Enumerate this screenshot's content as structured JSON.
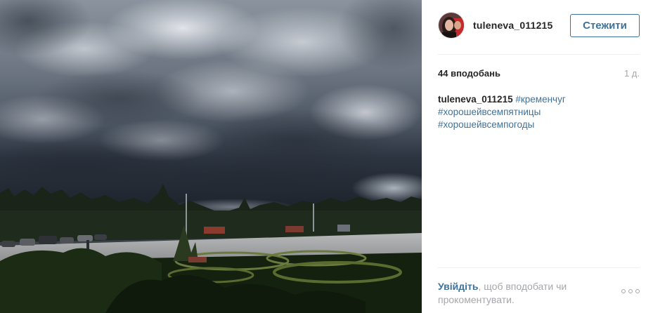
{
  "post": {
    "username": "tuleneva_011215",
    "follow_label": "Стежити",
    "likes": "44 вподобань",
    "time": "1 д.",
    "caption": {
      "author": "tuleneva_011215",
      "tags": [
        "#кременчуг",
        "#хорошейвсемпятницы",
        "#хорошейвсемпогоды"
      ]
    },
    "footer": {
      "login_link": "Увійдіть",
      "login_rest": ", щоб вподобати чи прокоментувати."
    }
  },
  "icons": {
    "more": "more-options-icon",
    "avatar": "user-avatar"
  },
  "colors": {
    "link": "#3f729b",
    "muted": "#a5a7aa",
    "text": "#262626"
  }
}
